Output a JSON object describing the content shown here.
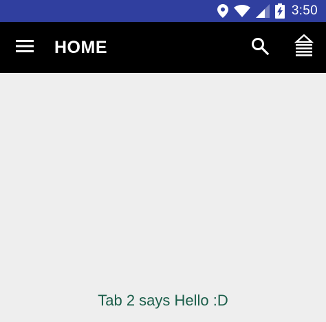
{
  "status_bar": {
    "time": "3:50",
    "icons": [
      "location-icon",
      "wifi-icon",
      "cell-signal-icon",
      "battery-charging-icon"
    ],
    "background": "#303f9f"
  },
  "app_bar": {
    "title": "HOME",
    "background": "#000000",
    "icons": [
      "menu-icon",
      "search-icon",
      "stack-icon"
    ]
  },
  "content": {
    "message": "Tab 2 says Hello :D",
    "message_color": "#1b5e4a",
    "background": "#eeeeee"
  }
}
